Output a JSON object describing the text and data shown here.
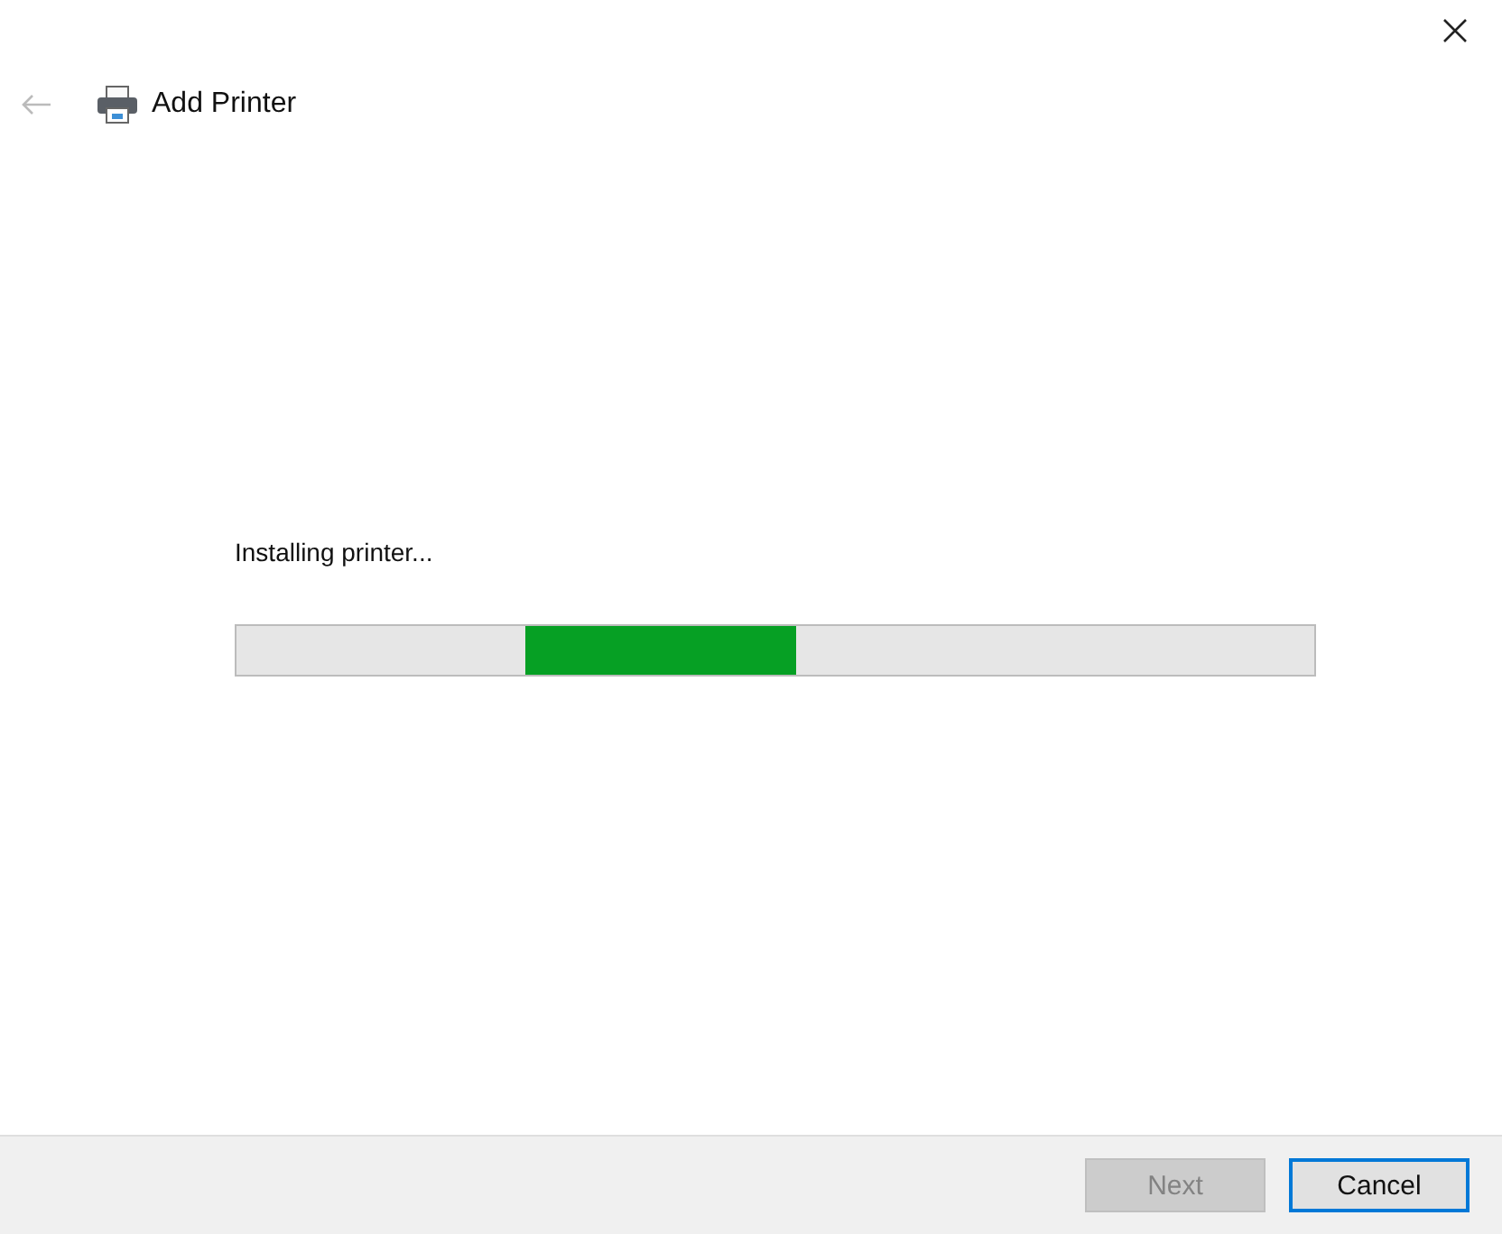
{
  "header": {
    "title": "Add Printer",
    "back_disabled": true
  },
  "status": "Installing printer...",
  "progress": {
    "kind": "marquee"
  },
  "buttons": [
    {
      "label": "Next",
      "disabled": true,
      "focused": false
    },
    {
      "label": "Cancel",
      "disabled": false,
      "focused": true
    }
  ]
}
